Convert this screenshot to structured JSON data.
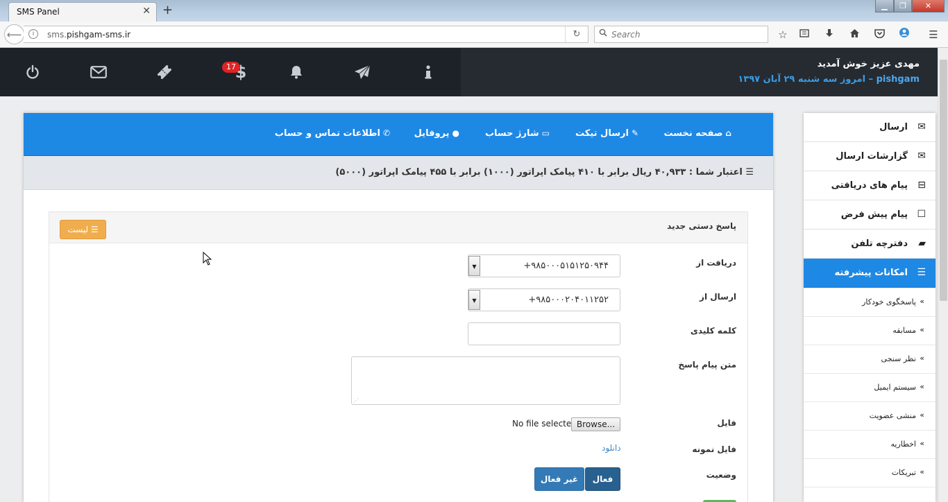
{
  "browser": {
    "tab_title": "SMS Panel",
    "tab_close": "✕",
    "new_tab": "+",
    "url_prefix": "sms.",
    "url_domain": "pishgam-sms.ir",
    "search_placeholder": "Search",
    "window_controls": {
      "minimize": "▁",
      "maximize": "❐",
      "close": "✕"
    }
  },
  "header": {
    "welcome": "مهدی عزیز خوش آمدید",
    "username": "pishgam",
    "date_text": "– امروز سه شنبه ۲۹ آبان ۱۳۹۷",
    "badge_count": "17",
    "icons": [
      "power-icon",
      "mail-icon",
      "ticket-icon",
      "dollar-icon",
      "bell-icon",
      "send-icon",
      "info-icon"
    ]
  },
  "topnav": {
    "home": "صفحه نخست",
    "ticket": "ارسال تیکت",
    "charge": "شارژ حساب",
    "profile": "پروفایل",
    "contact": "اطلاعات تماس و حساب"
  },
  "credit": {
    "text": "اعتبار شما : ۴۰,۹۳۳ ریال برابر با ۴۱۰ پیامک اپراتور (۱۰۰۰) برابر با ۴۵۵ پیامک اپراتور (۵۰۰۰)"
  },
  "form": {
    "title": "پاسخ دستی جدید",
    "list_button": "لیست",
    "receive_from_label": "دریافت از",
    "receive_from_value": "+۹۸۵۰۰۰۵۱۵۱۲۵۰۹۴۴",
    "send_from_label": "ارسال از",
    "send_from_value": "+۹۸۵۰۰۰۲۰۴۰۱۱۲۵۲",
    "keyword_label": "کلمه کلیدی",
    "keyword_value": "",
    "reply_text_label": "متن پیام پاسخ",
    "reply_text_value": "",
    "file_label": "فایل",
    "browse_button": "Browse...",
    "no_file_text": "No file selected.",
    "sample_file_label": "فایل نمونه",
    "download_link": "دانلود",
    "status_label": "وضعیت",
    "active_button": "فعال",
    "inactive_button": "غیر فعال"
  },
  "sidebar": {
    "items": [
      {
        "label": "ارسال",
        "icon": "envelope-icon"
      },
      {
        "label": "گزارشات ارسال",
        "icon": "envelope-outline-icon"
      },
      {
        "label": "پیام های دریافتی",
        "icon": "inbox-icon"
      },
      {
        "label": "پیام پیش فرض",
        "icon": "square-icon"
      },
      {
        "label": "دفترچه تلفن",
        "icon": "book-icon"
      }
    ],
    "active_item": {
      "label": "امکانات پیشرفته",
      "icon": "list-icon"
    },
    "subitems": [
      "پاسخگوی خودکار",
      "مسابقه",
      "نظر سنجی",
      "سیستم ایمیل",
      "منشی عضویت",
      "اخطاریه",
      "تبریکات"
    ],
    "colors": {
      "accent": "#1e88e5",
      "header_bg": "#1c2228",
      "list_btn": "#f0ad4e"
    }
  }
}
